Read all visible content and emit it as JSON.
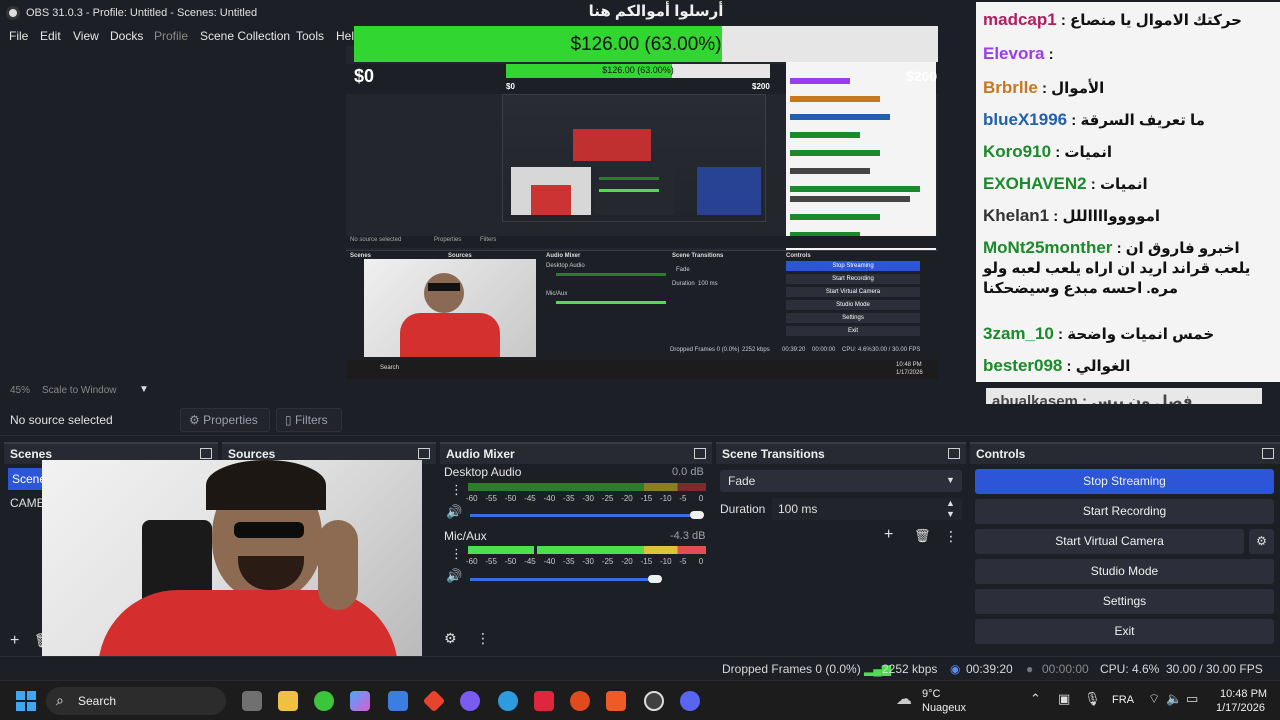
{
  "window": {
    "title": "OBS 31.0.3 - Profile: Untitled - Scenes: Untitled",
    "close_glyph": "✕"
  },
  "menu": [
    "File",
    "Edit",
    "View",
    "Docks",
    "Profile",
    "Scene Collection",
    "Tools",
    "Hel"
  ],
  "donation": {
    "heading": "أرسلوا أموالكم هنا",
    "progress_text": "$126.00 (63.00%)",
    "progress_fraction": 0.63,
    "min_label": "$0",
    "max_label": "$200",
    "fill_color": "#31d631"
  },
  "chat": {
    "messages": [
      {
        "user": "madcap1",
        "text": "حركتك الاموال يا منصاع",
        "color": "#b02060"
      },
      {
        "user": "Elevora",
        "text": "",
        "color": "#9a3df0"
      },
      {
        "user": "Brbrlle",
        "text": "الأموال",
        "color": "#c8781e"
      },
      {
        "user": "blueX1996",
        "text": "ما تعريف السرقة",
        "color": "#2060b0"
      },
      {
        "user": "Koro910",
        "text": "انميات",
        "color": "#1a8a2a"
      },
      {
        "user": "EXOHAVEN2",
        "text": "انميات",
        "color": "#1a8a2a"
      },
      {
        "user": "Khelan1",
        "text": "امووووااااللل",
        "color": "#333333"
      },
      {
        "user": "MoNt25monther",
        "text": "اخبرو فاروق ان يلعب قراند اريد ان اراه يلعب لعبه ولو مره. احسه مبدع وسيضحكنا",
        "color": "#1a8a2a"
      },
      {
        "user": "3zam_10",
        "text": "خمس انميات واضحة",
        "color": "#1a8a2a"
      },
      {
        "user": "bester098",
        "text": "الغوالي",
        "color": "#1a8a2a"
      },
      {
        "user": "abualkasem",
        "text": "فصل ون بيس",
        "color": "#444444"
      }
    ]
  },
  "preview_footer": {
    "zoom": "45%",
    "scale_mode": "Scale to Window",
    "no_source": "No source selected",
    "properties": "Properties",
    "filters": "Filters"
  },
  "docks": {
    "scenes": {
      "title": "Scenes",
      "items": [
        "Scene",
        "CAME"
      ]
    },
    "sources": {
      "title": "Sources"
    },
    "mixer": {
      "title": "Audio Mixer",
      "channels": [
        {
          "name": "Desktop Audio",
          "db": "0.0 dB",
          "level": 0.0,
          "volume": 1.0
        },
        {
          "name": "Mic/Aux",
          "db": "-4.3 dB",
          "level": 0.97,
          "volume": 0.8
        }
      ],
      "scale": [
        "-60",
        "-55",
        "-50",
        "-45",
        "-40",
        "-35",
        "-30",
        "-25",
        "-20",
        "-15",
        "-10",
        "-5",
        "0"
      ]
    },
    "transitions": {
      "title": "Scene Transitions",
      "selected": "Fade",
      "duration_label": "Duration",
      "duration_value": "100 ms"
    },
    "controls": {
      "title": "Controls",
      "buttons": [
        "Stop Streaming",
        "Start Recording",
        "Start Virtual Camera",
        "Studio Mode",
        "Settings",
        "Exit"
      ]
    }
  },
  "status": {
    "dropped": "Dropped Frames 0 (0.0%)",
    "bitrate": "2252 kbps",
    "stream_time": "00:39:20",
    "rec_time": "00:00:00",
    "cpu": "CPU: 4.6%",
    "fps": "30.00 / 30.00 FPS"
  },
  "taskbar": {
    "search": "Search",
    "weather_temp": "9°C",
    "weather_desc": "Nuageux",
    "lang": "FRA",
    "time": "10:48 PM",
    "date": "1/17/2026"
  },
  "inner_preview": {
    "progress_text": "$126.00 (63.00%)",
    "min_label": "$0",
    "max_label": "$200",
    "scenes_title": "Scenes",
    "sources_title": "Sources",
    "mixer_title": "Audio Mixer",
    "transitions_title": "Scene Transitions",
    "controls_title": "Controls",
    "stop_streaming": "Stop Streaming",
    "start_recording": "Start Recording",
    "start_virtual_camera": "Start Virtual Camera",
    "studio_mode": "Studio Mode",
    "settings": "Settings",
    "exit": "Exit",
    "no_source": "No source selected",
    "properties": "Properties",
    "filters": "Filters",
    "fade": "Fade",
    "duration": "Duration",
    "duration_value": "100 ms",
    "desktop_audio": "Desktop Audio",
    "mic_aux": "Mic/Aux",
    "dropped": "Dropped Frames 0 (0.0%)",
    "bitrate": "2252 kbps",
    "stream_time": "00:39:20",
    "rec_time": "00:00:00",
    "cpu": "CPU: 4.6%",
    "fps": "30.00 / 30.00 FPS",
    "search": "Search",
    "time": "10:48 PM",
    "date": "1/17/2026"
  }
}
